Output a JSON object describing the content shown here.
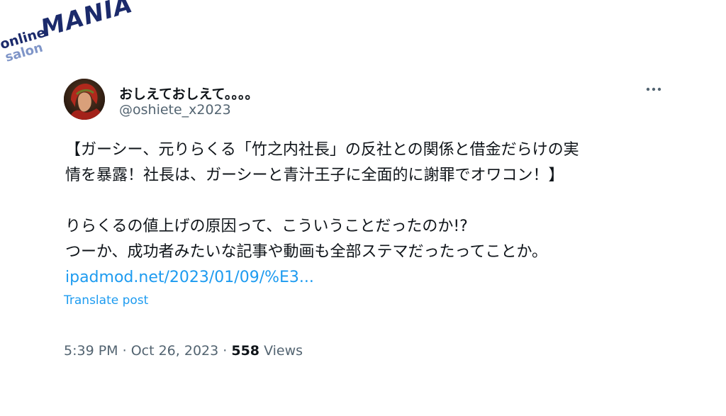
{
  "watermark": {
    "line1": "online",
    "line2": "salon",
    "brand": "MANIA"
  },
  "tweet": {
    "author": {
      "display_name": "おしえておしえて。。。。",
      "handle": "@oshiete_x2023"
    },
    "more_icon": "more-horizontal-icon",
    "body": {
      "line1": "【ガーシー、元りらくる「竹之内社長」の反社との関係と借金だらけの実",
      "line2": "情を暴露！社長は、ガーシーと青汁王子に全面的に謝罪でオワコン！】",
      "line3": "りらくるの値上げの原因って、こういうことだったのか!?",
      "line4": "つーか、成功者みたいな記事や動画も全部ステマだったってことか。",
      "link_text": "ipadmod.net/2023/01/09/%E3..."
    },
    "translate_label": "Translate post",
    "time": "5:39 PM",
    "separator": "·",
    "date": "Oct 26, 2023",
    "views_count": "558",
    "views_label": "Views"
  },
  "colors": {
    "text_primary": "#0f1419",
    "text_secondary": "#536471",
    "link": "#1d9bf0",
    "logo_dark": "#1b2a6b",
    "logo_light": "#7f95c8"
  }
}
